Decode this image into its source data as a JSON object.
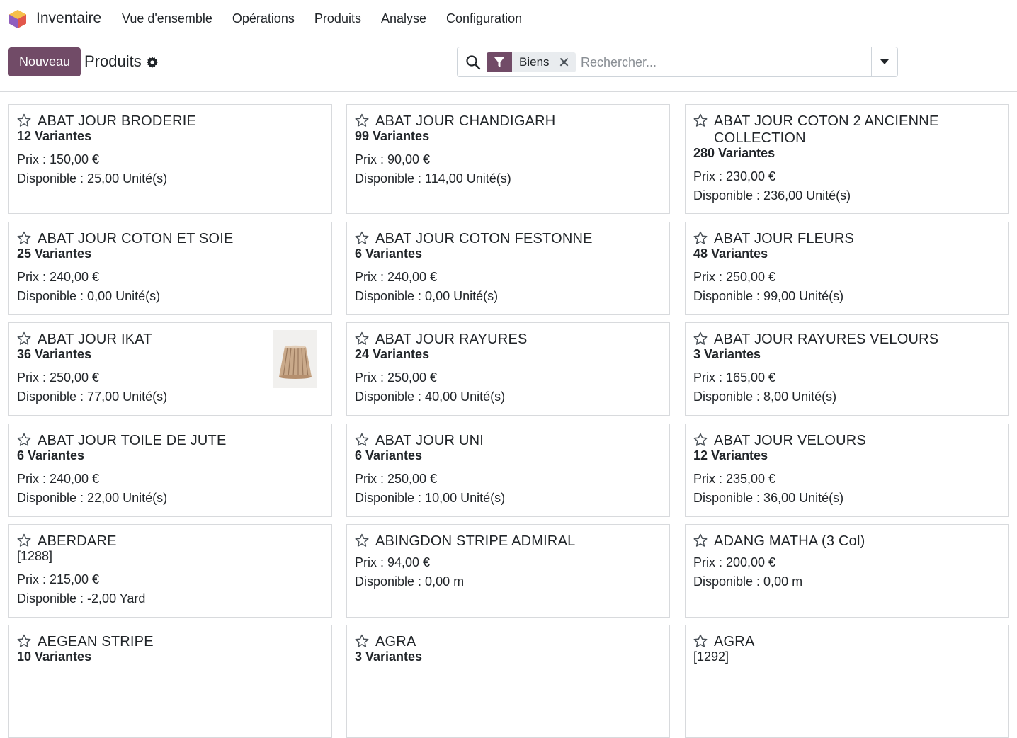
{
  "app": {
    "name": "Inventaire"
  },
  "menu": [
    "Vue d'ensemble",
    "Opérations",
    "Produits",
    "Analyse",
    "Configuration"
  ],
  "toolbar": {
    "new_label": "Nouveau",
    "title": "Produits"
  },
  "search": {
    "facet": "Biens",
    "placeholder": "Rechercher..."
  },
  "colors": {
    "brand": "#714b67",
    "border": "#d8dadd"
  },
  "products": [
    {
      "name_lines": [
        "ABAT JOUR BRODERIE"
      ],
      "sub": "12 Variantes",
      "price": "Prix : 150,00 €",
      "available": "Disponible : 25,00 Unité(s)"
    },
    {
      "name_lines": [
        "ABAT JOUR CHANDIGARH"
      ],
      "sub": "99 Variantes",
      "price": "Prix : 90,00 €",
      "available": "Disponible : 114,00 Unité(s)"
    },
    {
      "name_lines": [
        "ABAT JOUR COTON 2 ANCIENNE",
        "COLLECTION"
      ],
      "sub": "280 Variantes",
      "price": "Prix : 230,00 €",
      "available": "Disponible : 236,00 Unité(s)"
    },
    {
      "name_lines": [
        "ABAT JOUR COTON ET SOIE"
      ],
      "sub": "25 Variantes",
      "price": "Prix : 240,00 €",
      "available": "Disponible : 0,00 Unité(s)"
    },
    {
      "name_lines": [
        "ABAT JOUR COTON FESTONNE"
      ],
      "sub": "6 Variantes",
      "price": "Prix : 240,00 €",
      "available": "Disponible : 0,00 Unité(s)"
    },
    {
      "name_lines": [
        "ABAT JOUR FLEURS"
      ],
      "sub": "48 Variantes",
      "price": "Prix : 250,00 €",
      "available": "Disponible : 99,00 Unité(s)"
    },
    {
      "name_lines": [
        "ABAT JOUR IKAT"
      ],
      "sub": "36 Variantes",
      "price": "Prix : 250,00 €",
      "available": "Disponible : 77,00 Unité(s)",
      "has_image": true
    },
    {
      "name_lines": [
        "ABAT JOUR RAYURES"
      ],
      "sub": "24 Variantes",
      "price": "Prix : 250,00 €",
      "available": "Disponible : 40,00 Unité(s)"
    },
    {
      "name_lines": [
        "ABAT JOUR RAYURES VELOURS"
      ],
      "sub": "3 Variantes",
      "price": "Prix : 165,00 €",
      "available": "Disponible : 8,00 Unité(s)"
    },
    {
      "name_lines": [
        "ABAT JOUR TOILE DE JUTE"
      ],
      "sub": "6 Variantes",
      "price": "Prix : 240,00 €",
      "available": "Disponible : 22,00 Unité(s)"
    },
    {
      "name_lines": [
        "ABAT JOUR UNI"
      ],
      "sub": "6 Variantes",
      "price": "Prix : 250,00 €",
      "available": "Disponible : 10,00 Unité(s)"
    },
    {
      "name_lines": [
        "ABAT JOUR VELOURS"
      ],
      "sub": "12 Variantes",
      "price": "Prix : 235,00 €",
      "available": "Disponible : 36,00 Unité(s)"
    },
    {
      "name_lines": [
        "ABERDARE"
      ],
      "sub": "[1288]",
      "sub_plain": true,
      "price": "Prix : 215,00 €",
      "available": "Disponible : -2,00 Yard"
    },
    {
      "name_lines": [
        "ABINGDON STRIPE ADMIRAL"
      ],
      "price": "Prix : 94,00 €",
      "available": "Disponible : 0,00 m"
    },
    {
      "name_lines": [
        "ADANG MATHA (3 Col)"
      ],
      "price": "Prix : 200,00 €",
      "available": "Disponible : 0,00 m"
    },
    {
      "name_lines": [
        "AEGEAN STRIPE"
      ],
      "sub": "10 Variantes"
    },
    {
      "name_lines": [
        "AGRA"
      ],
      "sub": "3 Variantes"
    },
    {
      "name_lines": [
        "AGRA"
      ],
      "sub": "[1292]",
      "sub_plain": true
    }
  ]
}
